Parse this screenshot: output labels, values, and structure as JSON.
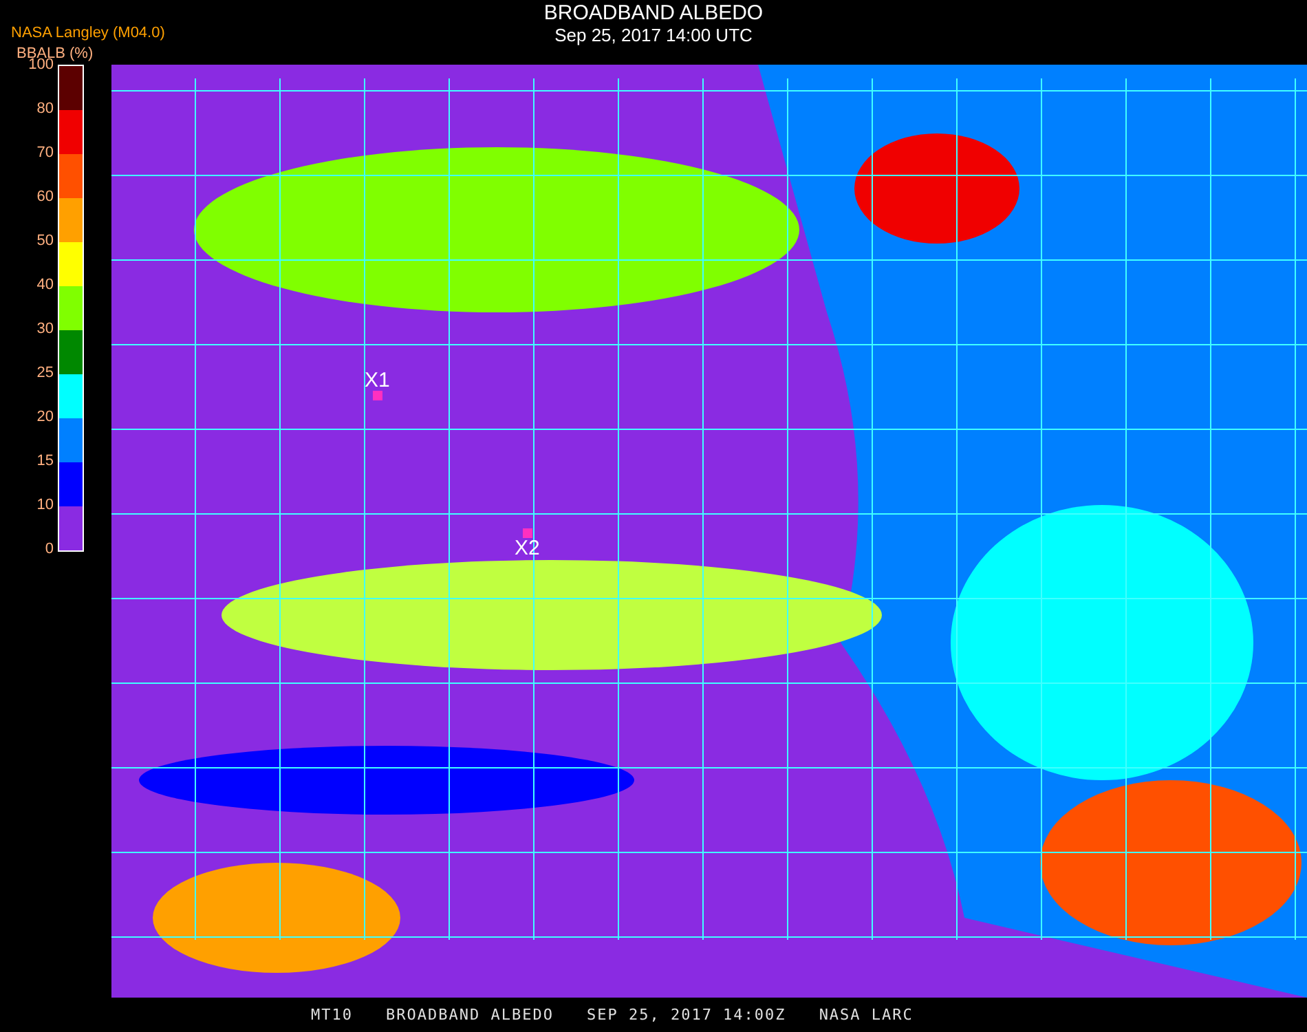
{
  "header": {
    "source": "NASA Langley (M04.0)",
    "title": "BROADBAND ALBEDO",
    "datetime": "Sep 25, 2017 14:00 UTC"
  },
  "legend": {
    "label": "BBALB (%)",
    "ticks": [
      "100",
      "80",
      "70",
      "60",
      "50",
      "40",
      "30",
      "25",
      "20",
      "15",
      "10",
      "0"
    ],
    "segments": [
      {
        "color": "#5c0000"
      },
      {
        "color": "#f00000"
      },
      {
        "color": "#ff5000"
      },
      {
        "color": "#ffa000"
      },
      {
        "color": "#ffff00"
      },
      {
        "color": "#80ff00"
      },
      {
        "color": "#008800"
      },
      {
        "color": "#00ffff"
      },
      {
        "color": "#0080ff"
      },
      {
        "color": "#0000ff"
      },
      {
        "color": "#8a2be2"
      }
    ]
  },
  "markers": [
    {
      "label": "X1"
    },
    {
      "label": "X2"
    }
  ],
  "footer": [
    "MT10",
    "BROADBAND ALBEDO",
    "SEP 25, 2017 14:00Z",
    "NASA LARC"
  ]
}
